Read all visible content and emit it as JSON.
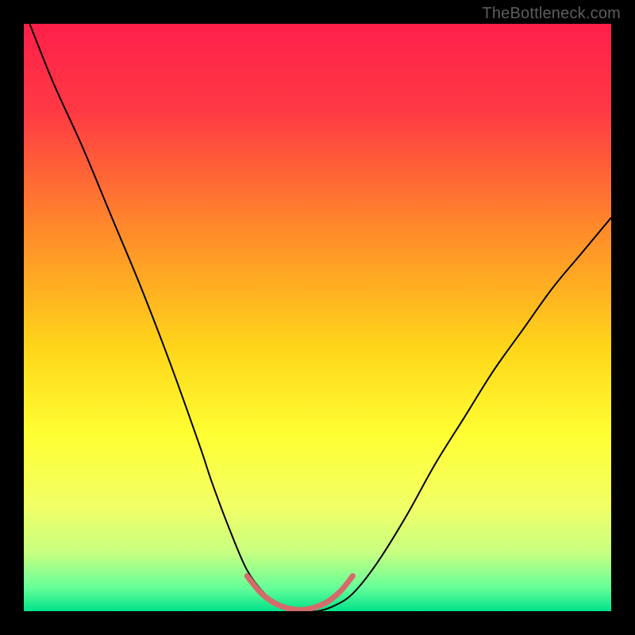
{
  "watermark": "TheBottleneck.com",
  "chart_data": {
    "type": "line",
    "title": "",
    "xlabel": "",
    "ylabel": "",
    "xlim": [
      0,
      100
    ],
    "ylim": [
      0,
      100
    ],
    "grid": false,
    "legend": false,
    "background_gradient": {
      "stops": [
        {
          "pos": 0.0,
          "color": "#ff1f4a"
        },
        {
          "pos": 0.15,
          "color": "#ff3a44"
        },
        {
          "pos": 0.35,
          "color": "#ff8a2a"
        },
        {
          "pos": 0.55,
          "color": "#ffd51a"
        },
        {
          "pos": 0.7,
          "color": "#ffff33"
        },
        {
          "pos": 0.82,
          "color": "#f2ff66"
        },
        {
          "pos": 0.9,
          "color": "#c8ff80"
        },
        {
          "pos": 0.96,
          "color": "#66ff99"
        },
        {
          "pos": 1.0,
          "color": "#00e28a"
        }
      ]
    },
    "series": [
      {
        "name": "bottleneck-curve",
        "color": "#000000",
        "width": 2,
        "x": [
          1,
          5,
          10,
          15,
          20,
          25,
          30,
          32,
          35,
          38,
          41,
          44,
          47,
          50,
          53,
          56,
          60,
          65,
          70,
          75,
          80,
          85,
          90,
          95,
          100
        ],
        "y": [
          100,
          90,
          79,
          67,
          55,
          42,
          28,
          22,
          14,
          7,
          3,
          1,
          0,
          0,
          1,
          3,
          8,
          16,
          25,
          33,
          41,
          48,
          55,
          61,
          67
        ]
      },
      {
        "name": "bottom-highlight",
        "color": "#d66a6a",
        "width": 7,
        "x": [
          38,
          40,
          42,
          44,
          46,
          48,
          50,
          52,
          54,
          56
        ],
        "y": [
          6,
          3.5,
          1.8,
          0.8,
          0.3,
          0.3,
          0.8,
          1.8,
          3.5,
          6
        ]
      }
    ],
    "annotations": []
  }
}
